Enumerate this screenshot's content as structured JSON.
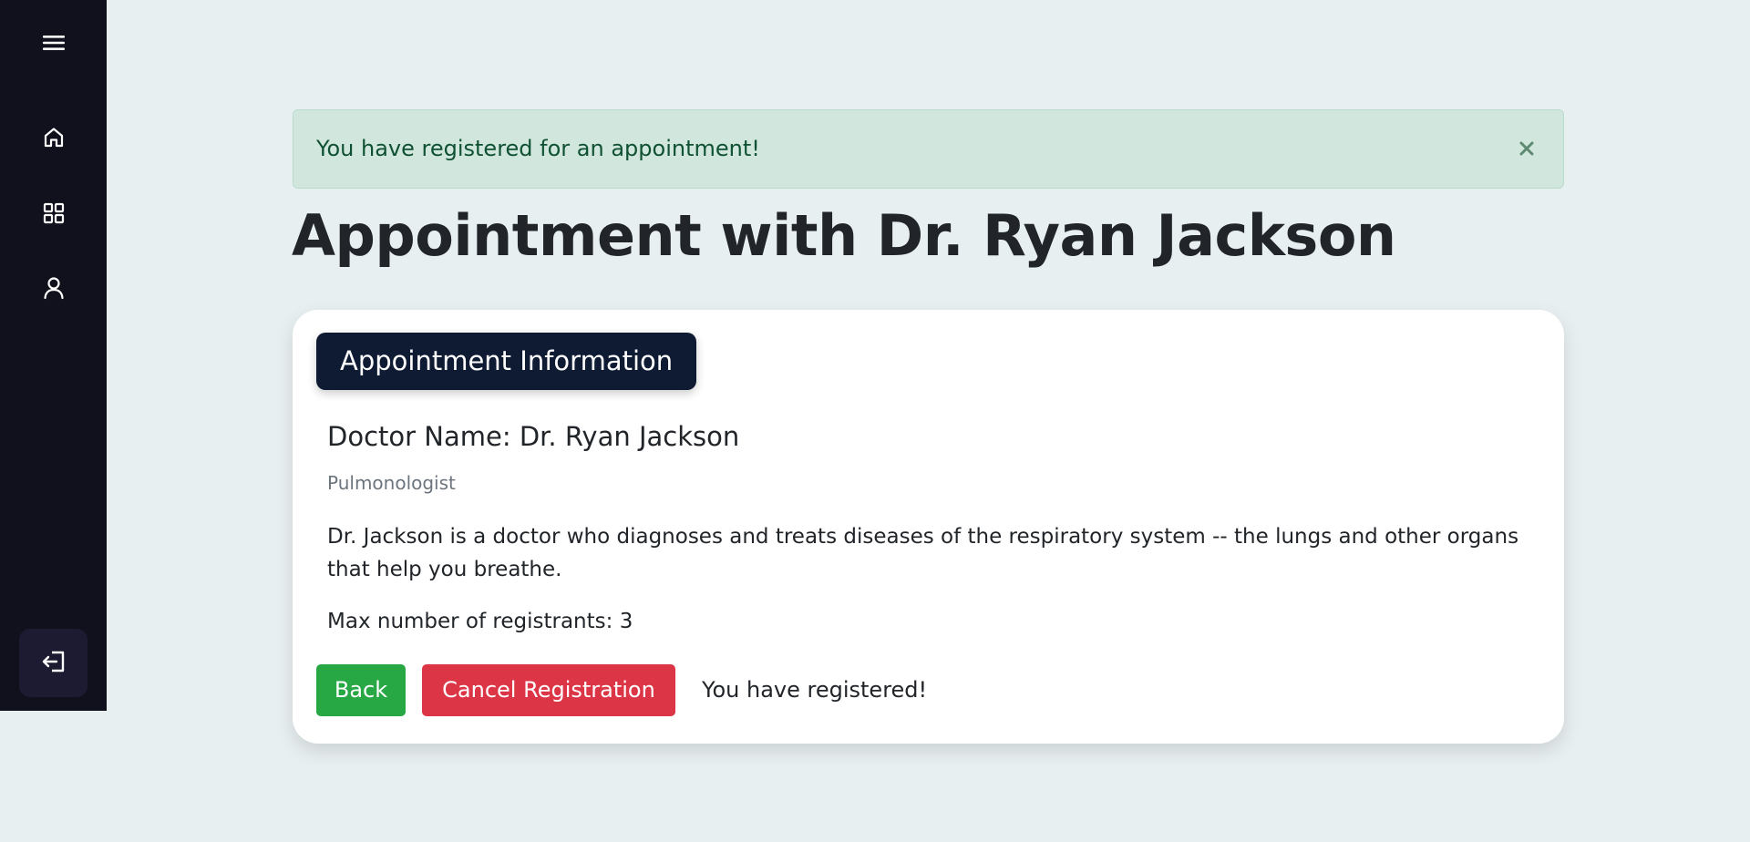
{
  "sidebar": {
    "menu_icon": "hamburger-menu-icon",
    "items": [
      {
        "name": "home",
        "icon": "home-icon"
      },
      {
        "name": "dashboard",
        "icon": "grid-icon"
      },
      {
        "name": "profile",
        "icon": "user-icon"
      }
    ],
    "logout_icon": "logout-icon"
  },
  "alert": {
    "message": "You have registered for an appointment!",
    "close_icon": "close-icon"
  },
  "page": {
    "title": "Appointment with Dr. Ryan Jackson"
  },
  "card": {
    "header": "Appointment Information",
    "doctor_name": "Doctor Name: Dr. Ryan Jackson",
    "specialty": "Pulmonologist",
    "description": "Dr. Jackson is a doctor who diagnoses and treats diseases of the respiratory system -- the lungs and other organs that help you breathe.",
    "max_registrants": "Max number of registrants: 3",
    "back_label": "Back",
    "cancel_label": "Cancel Registration",
    "status_message": "You have registered!"
  },
  "colors": {
    "sidebar_bg": "#11101d",
    "alert_bg": "#d1e7dd",
    "alert_text": "#0f5132",
    "header_bg": "#0f1b33",
    "back_btn": "#28a745",
    "cancel_btn": "#dc3545",
    "page_bg": "#e8eff1"
  }
}
